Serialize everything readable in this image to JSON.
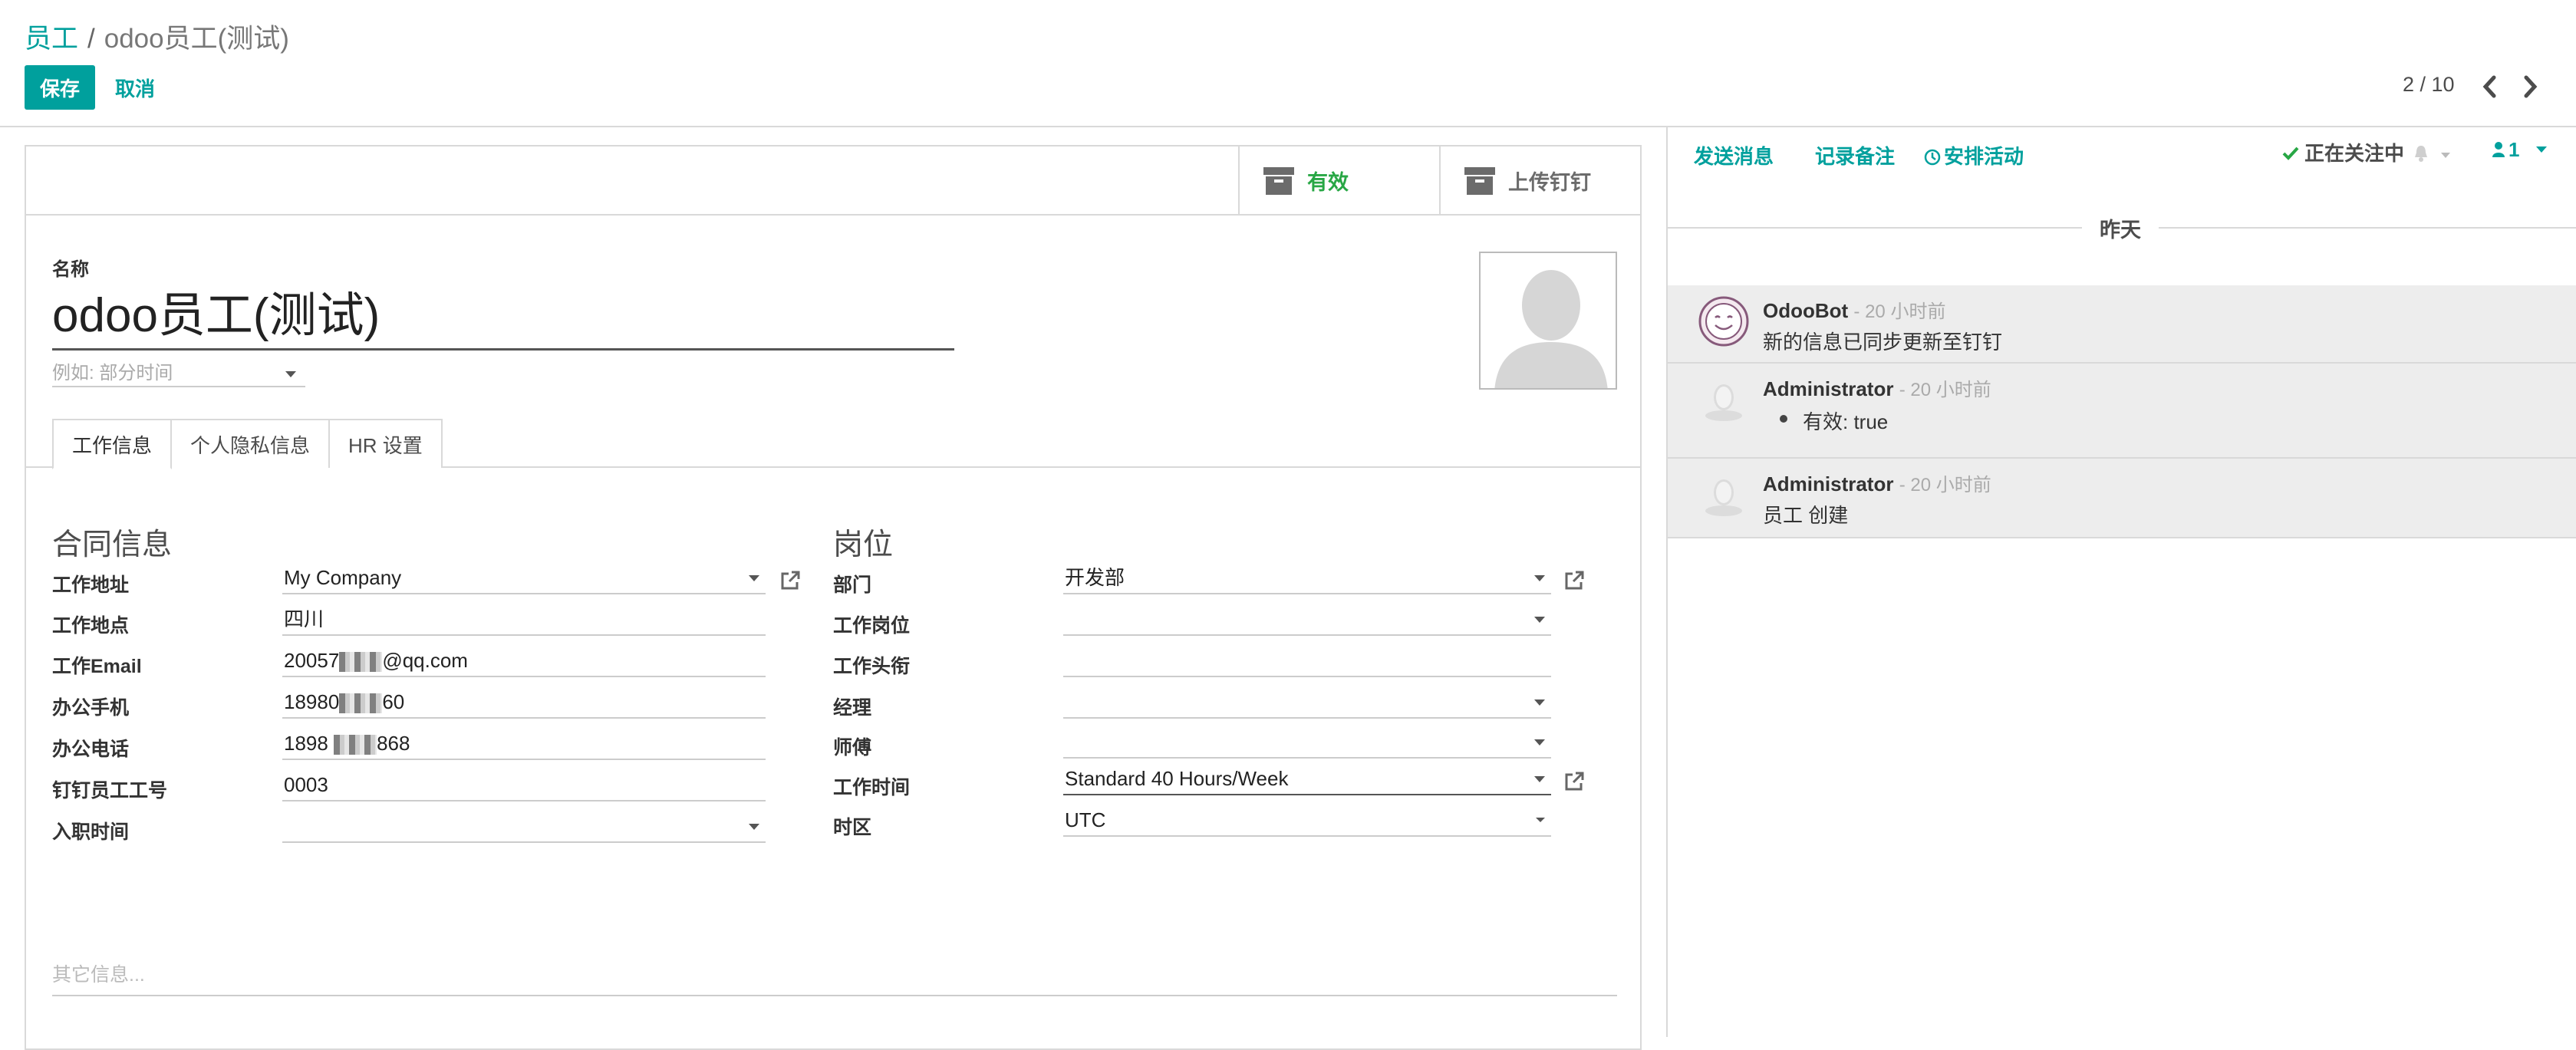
{
  "breadcrumb": {
    "parent": "员工",
    "separator": "/",
    "current": "odoo员工(测试)"
  },
  "actions": {
    "save": "保存",
    "discard": "取消"
  },
  "pager": {
    "value": "2 / 10"
  },
  "smart_buttons": {
    "active": "有效",
    "upload": "上传钉钉"
  },
  "form": {
    "name_label": "名称",
    "name_value": "odoo员工(测试)",
    "tags_placeholder": "例如:  部分时间",
    "tabs": [
      "工作信息",
      "个人隐私信息",
      "HR 设置"
    ],
    "left_group": {
      "title": "合同信息",
      "fields": [
        {
          "label": "工作地址",
          "value": "My Company"
        },
        {
          "label": "工作地点",
          "value": "四川"
        },
        {
          "label": "工作Email",
          "value_prefix": "20057",
          "value_suffix": "@qq.com"
        },
        {
          "label": "办公手机",
          "value_prefix": "18980",
          "value_suffix": "60"
        },
        {
          "label": "办公电话",
          "value_prefix": "1898",
          "value_suffix": "868"
        },
        {
          "label": "钉钉员工工号",
          "value": "0003"
        },
        {
          "label": "入职时间",
          "value": ""
        }
      ]
    },
    "right_group": {
      "title": "岗位",
      "fields": [
        {
          "label": "部门",
          "value": "开发部"
        },
        {
          "label": "工作岗位",
          "value": ""
        },
        {
          "label": "工作头衔",
          "value": ""
        },
        {
          "label": "经理",
          "value": ""
        },
        {
          "label": "师傅",
          "value": ""
        },
        {
          "label": "工作时间",
          "value": "Standard 40 Hours/Week"
        },
        {
          "label": "时区",
          "value": "UTC"
        }
      ]
    },
    "notes_placeholder": "其它信息..."
  },
  "chatter": {
    "send_message": "发送消息",
    "log_note": "记录备注",
    "schedule_activity": "安排活动",
    "following": "正在关注中",
    "followers_count": "1",
    "date_separator": "昨天",
    "messages": [
      {
        "author": "OdooBot",
        "date": "- 20 小时前",
        "body": "新的信息已同步更新至钉钉"
      },
      {
        "author": "Administrator",
        "date": "- 20 小时前",
        "body": "有效: true"
      },
      {
        "author": "Administrator",
        "date": "- 20 小时前",
        "body": "员工 创建"
      }
    ]
  },
  "colors": {
    "primary": "#00a09d",
    "success": "#28a745",
    "muted_bg": "#ededed"
  }
}
